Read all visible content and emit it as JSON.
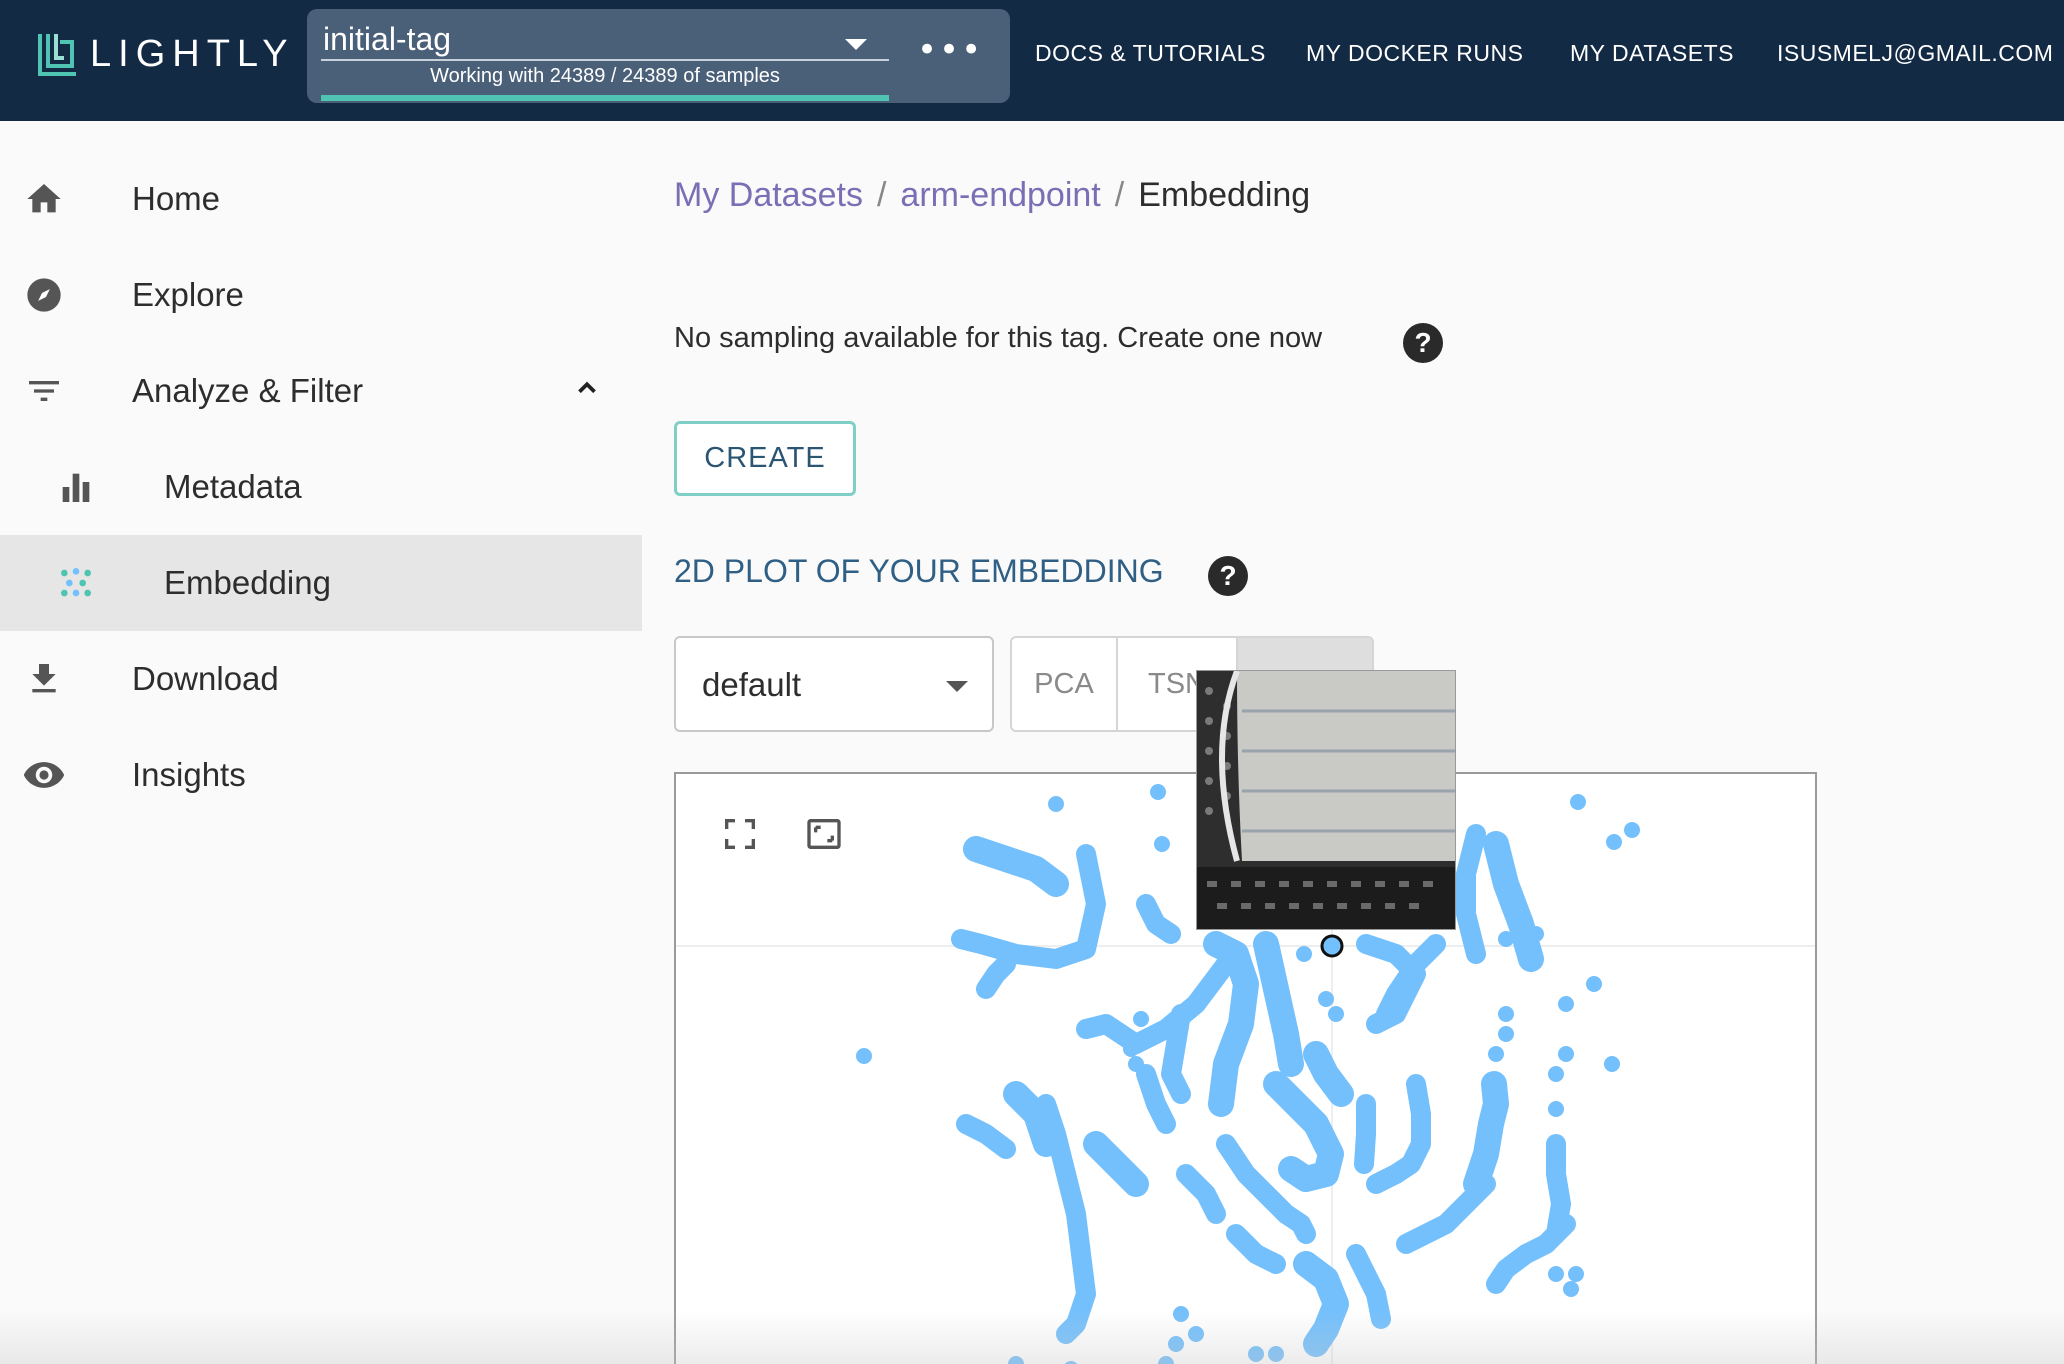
{
  "app": {
    "logo_text": "LIGHTLY"
  },
  "tag_selector": {
    "name": "initial-tag",
    "subtitle": "Working with 24389 / 24389 of samples",
    "more_icon": "more-horizontal-icon"
  },
  "nav": {
    "docs": "DOCS & TUTORIALS",
    "docker_runs": "MY DOCKER RUNS",
    "datasets": "MY DATASETS",
    "account": "ISUSMELJ@GMAIL.COM"
  },
  "sidebar": {
    "items": [
      {
        "label": "Home",
        "icon": "home-icon"
      },
      {
        "label": "Explore",
        "icon": "compass-icon"
      },
      {
        "label": "Analyze & Filter",
        "icon": "filter-icon",
        "expanded": true
      },
      {
        "label": "Metadata",
        "icon": "bar-chart-icon"
      },
      {
        "label": "Embedding",
        "icon": "scatter-icon",
        "active": true
      },
      {
        "label": "Download",
        "icon": "download-icon"
      },
      {
        "label": "Insights",
        "icon": "eye-icon"
      }
    ]
  },
  "breadcrumb": {
    "datasets": "My Datasets",
    "sep": "/",
    "dataset": "arm-endpoint",
    "current": "Embedding"
  },
  "sampling": {
    "message": "No sampling available for this tag. Create one now",
    "create_label": "CREATE"
  },
  "embedding": {
    "title": "2D PLOT OF YOUR EMBEDDING",
    "select_value": "default",
    "methods": [
      "PCA",
      "TSN",
      ""
    ],
    "selected_method_index": 2
  },
  "colors": {
    "topbar": "#132a45",
    "accent": "#4fc4b2",
    "link": "#7b6eb5",
    "points": "#74c0fc"
  }
}
